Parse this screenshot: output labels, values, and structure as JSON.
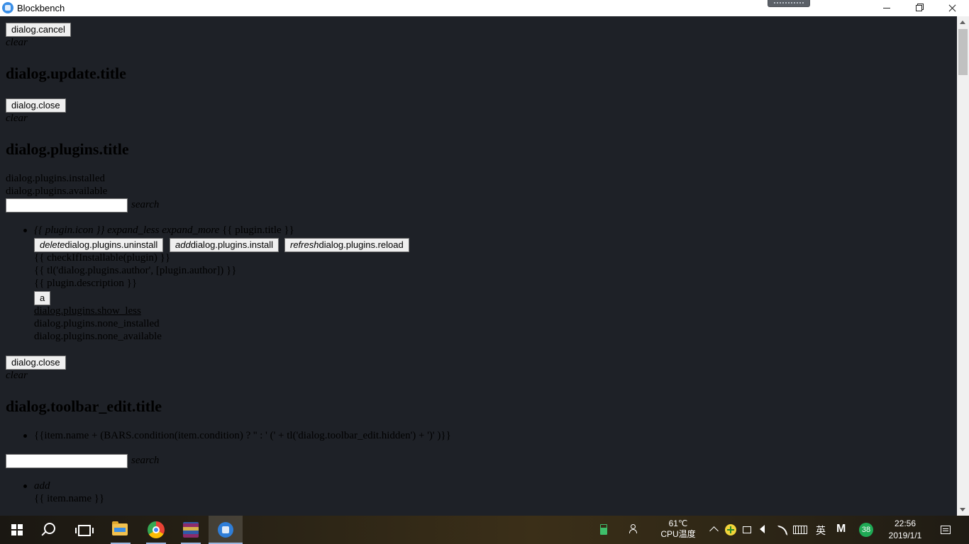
{
  "window": {
    "title": "Blockbench",
    "controls": {
      "minimize": "minimize",
      "maximize": "maximize",
      "close": "close"
    }
  },
  "content": {
    "dialog_cancel": "dialog.cancel",
    "clear_1": "clear",
    "update_title": "dialog.update.title",
    "close_1": "dialog.close",
    "clear_2": "clear",
    "plugins_title": "dialog.plugins.title",
    "plugins_installed": "dialog.plugins.installed",
    "plugins_available": "dialog.plugins.available",
    "search_1_placeholder": "",
    "search_1_icon": "search",
    "plugin_item": {
      "header_icon": "{{ plugin.icon }}",
      "expand_less": "expand_less",
      "expand_more": "expand_more",
      "title": "{{ plugin.title }}",
      "uninstall_icon": "delete",
      "uninstall_label": "dialog.plugins.uninstall",
      "install_icon": "add",
      "install_label": "dialog.plugins.install",
      "reload_icon": "refresh",
      "reload_label": "dialog.plugins.reload",
      "installable": "{{ checkIfInstallable(plugin) }}",
      "author": "{{ tl('dialog.plugins.author', [plugin.author]) }}",
      "description": "{{ plugin.description }}",
      "a_button": "a",
      "show_less": "dialog.plugins.show_less",
      "none_installed": "dialog.plugins.none_installed",
      "none_available": "dialog.plugins.none_available"
    },
    "close_2": "dialog.close",
    "clear_3": "clear",
    "toolbar_title": "dialog.toolbar_edit.title",
    "toolbar_item": "{{item.name + (BARS.condition(item.condition) ? '' : ' (' + tl('dialog.toolbar_edit.hidden') + ')' )}}",
    "search_2_placeholder": "",
    "search_2_icon": "search",
    "add_item_icon": "add",
    "add_item_name": "{{ item.name }}"
  },
  "taskbar": {
    "apps": [
      "start",
      "search",
      "task-view",
      "file-explorer",
      "chrome",
      "winrar",
      "blockbench"
    ],
    "cpu_temp": "61℃",
    "cpu_label": "CPU温度",
    "ime": "英",
    "m_icon": "M",
    "badge_count": "38",
    "time": "22:56",
    "date": "2019/1/1"
  }
}
